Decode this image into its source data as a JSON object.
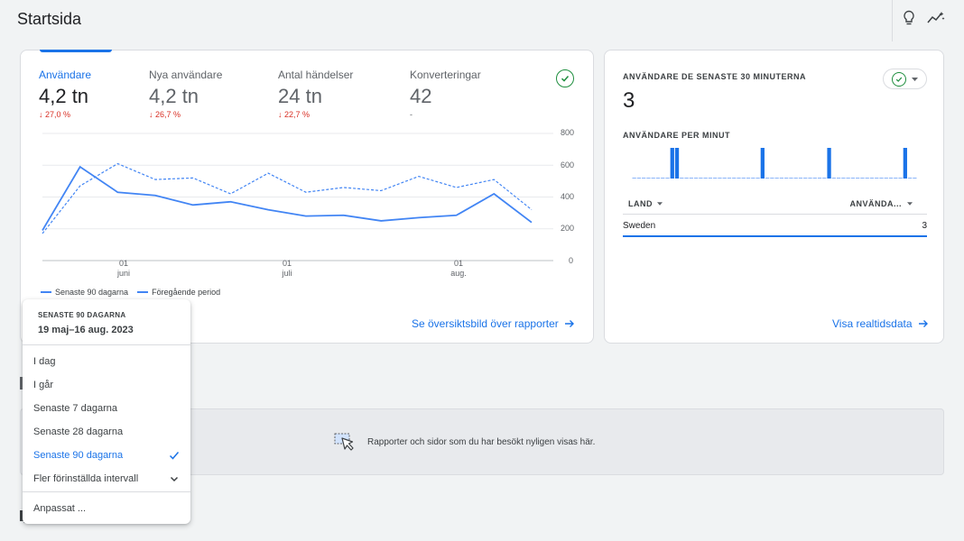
{
  "header": {
    "title": "Startsida",
    "icons": [
      "lightbulb-icon",
      "insights-icon"
    ]
  },
  "overview": {
    "metrics": [
      {
        "label": "Användare",
        "value": "4,2 tn",
        "change": "27,0 %",
        "active": true
      },
      {
        "label": "Nya användare",
        "value": "4,2 tn",
        "change": "26,7 %",
        "active": false
      },
      {
        "label": "Antal händelser",
        "value": "24 tn",
        "change": "22,7 %",
        "active": false
      },
      {
        "label": "Konverteringar",
        "value": "42",
        "change": "-",
        "active": false
      }
    ],
    "y_ticks": [
      "800",
      "600",
      "400",
      "200",
      "0"
    ],
    "x_ticks": [
      {
        "day": "01",
        "month": "juni"
      },
      {
        "day": "01",
        "month": "juli"
      },
      {
        "day": "01",
        "month": "aug."
      }
    ],
    "legend": {
      "current": "Senaste 90 dagarna",
      "previous": "Föregående period"
    },
    "link": "Se översiktsbild över rapporter",
    "accent_color": "#1a73e8",
    "negative_color": "#d93025",
    "chart_data": {
      "type": "line",
      "ylim": [
        0,
        800
      ],
      "x": [
        1,
        2,
        3,
        4,
        5,
        6,
        7,
        8,
        9,
        10,
        11,
        12,
        13,
        14
      ],
      "series": [
        {
          "name": "Senaste 90 dagarna",
          "values": [
            190,
            590,
            430,
            410,
            350,
            370,
            320,
            280,
            285,
            250,
            270,
            285,
            420,
            240
          ]
        },
        {
          "name": "Föregående period",
          "values": [
            170,
            470,
            610,
            510,
            520,
            420,
            550,
            430,
            460,
            440,
            530,
            460,
            510,
            320
          ]
        }
      ]
    }
  },
  "realtime": {
    "title": "ANVÄNDARE DE SENASTE 30 MINUTERNA",
    "value": "3",
    "subtitle": "ANVÄNDARE PER MINUT",
    "per_minute": [
      0,
      0,
      0,
      0,
      0,
      0,
      0,
      0,
      1,
      1,
      0,
      0,
      0,
      0,
      0,
      0,
      0,
      0,
      0,
      0,
      0,
      0,
      0,
      0,
      0,
      0,
      0,
      1,
      0,
      0,
      0,
      0,
      0,
      0,
      0,
      0,
      0,
      0,
      0,
      0,
      0,
      1,
      0,
      0,
      0,
      0,
      0,
      0,
      0,
      0,
      0,
      0,
      0,
      0,
      0,
      0,
      0,
      1,
      0,
      0
    ],
    "table": {
      "col1": "LAND",
      "col2": "ANVÄNDA...",
      "rows": [
        {
          "country": "Sweden",
          "users": "3"
        }
      ]
    },
    "link": "Visa realtidsdata"
  },
  "recent": {
    "text": "Rapporter och sidor som du har besökt nyligen visas här."
  },
  "menu": {
    "head_title": "SENASTE 90 DAGARNA",
    "head_date": "19 maj–16 aug. 2023",
    "items": [
      {
        "label": "I dag"
      },
      {
        "label": "I går"
      },
      {
        "label": "Senaste 7 dagarna"
      },
      {
        "label": "Senaste 28 dagarna"
      },
      {
        "label": "Senaste 90 dagarna",
        "selected": true
      },
      {
        "label": "Fler förinställda intervall",
        "expandable": true
      }
    ],
    "custom": "Anpassat ..."
  }
}
